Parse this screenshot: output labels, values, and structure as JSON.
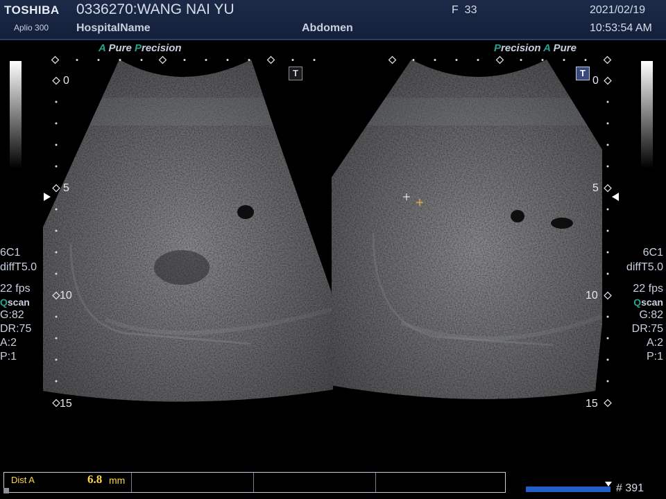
{
  "header": {
    "brand": "TOSHIBA",
    "model": "Aplio 300",
    "patient_id_name": "0336270:WANG NAI YU",
    "hospital": "HospitalName",
    "sex_age": "F  33",
    "region": "Abdomen",
    "date": "2021/02/19",
    "time": "10:53:54 AM"
  },
  "left_panel": {
    "logo_a": "A",
    "logo_pure": "Pure",
    "logo_p": "P",
    "logo_precision": "recision",
    "t_button": "T",
    "depth_ticks": [
      "0",
      "5",
      "10",
      "15"
    ]
  },
  "right_panel": {
    "logo_p": "P",
    "logo_precision": "recision",
    "logo_a": "A",
    "logo_pure": "Pure",
    "t_button": "T",
    "depth_ticks": [
      "0",
      "5",
      "10",
      "15"
    ]
  },
  "params_left": {
    "probe": "6C1",
    "mode": "diffT5.0",
    "fps": "22 fps",
    "q_letter": "Q",
    "q_rest": "scan",
    "gain": "G:82",
    "dr": "DR:75",
    "a": "A:2",
    "p": "P:1"
  },
  "params_right": {
    "probe": "6C1",
    "mode": "diffT5.0",
    "fps": "22 fps",
    "q_letter": "Q",
    "q_rest": "scan",
    "gain": "G:82",
    "dr": "DR:75",
    "a": "A:2",
    "p": "P:1"
  },
  "measurement": {
    "label": "Dist A",
    "value": "6.8",
    "unit": "mm"
  },
  "cine": {
    "frame_count": "# 391"
  },
  "colors": {
    "accent_teal": "#2aa090",
    "header_bg": "#1c2a48",
    "measure_yellow": "#ffd84a",
    "cine_blue": "#2060c8"
  }
}
